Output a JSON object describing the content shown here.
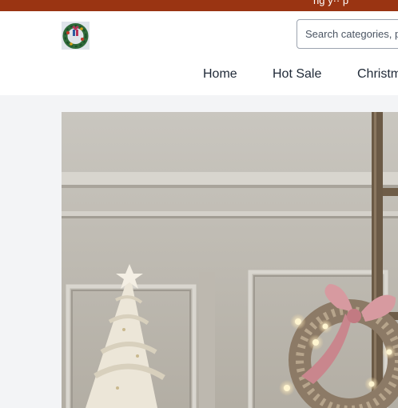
{
  "topbar": {
    "text": "ng y·· p",
    "color": "#9a3412"
  },
  "header": {
    "logo_icon": "christmas-wreath-icon",
    "search": {
      "placeholder": "Search categories, p"
    }
  },
  "nav": {
    "items": [
      {
        "label": "Home"
      },
      {
        "label": "Hot Sale"
      },
      {
        "label": "Christm"
      }
    ]
  },
  "hero": {
    "image": "christmas-decor-banner"
  }
}
